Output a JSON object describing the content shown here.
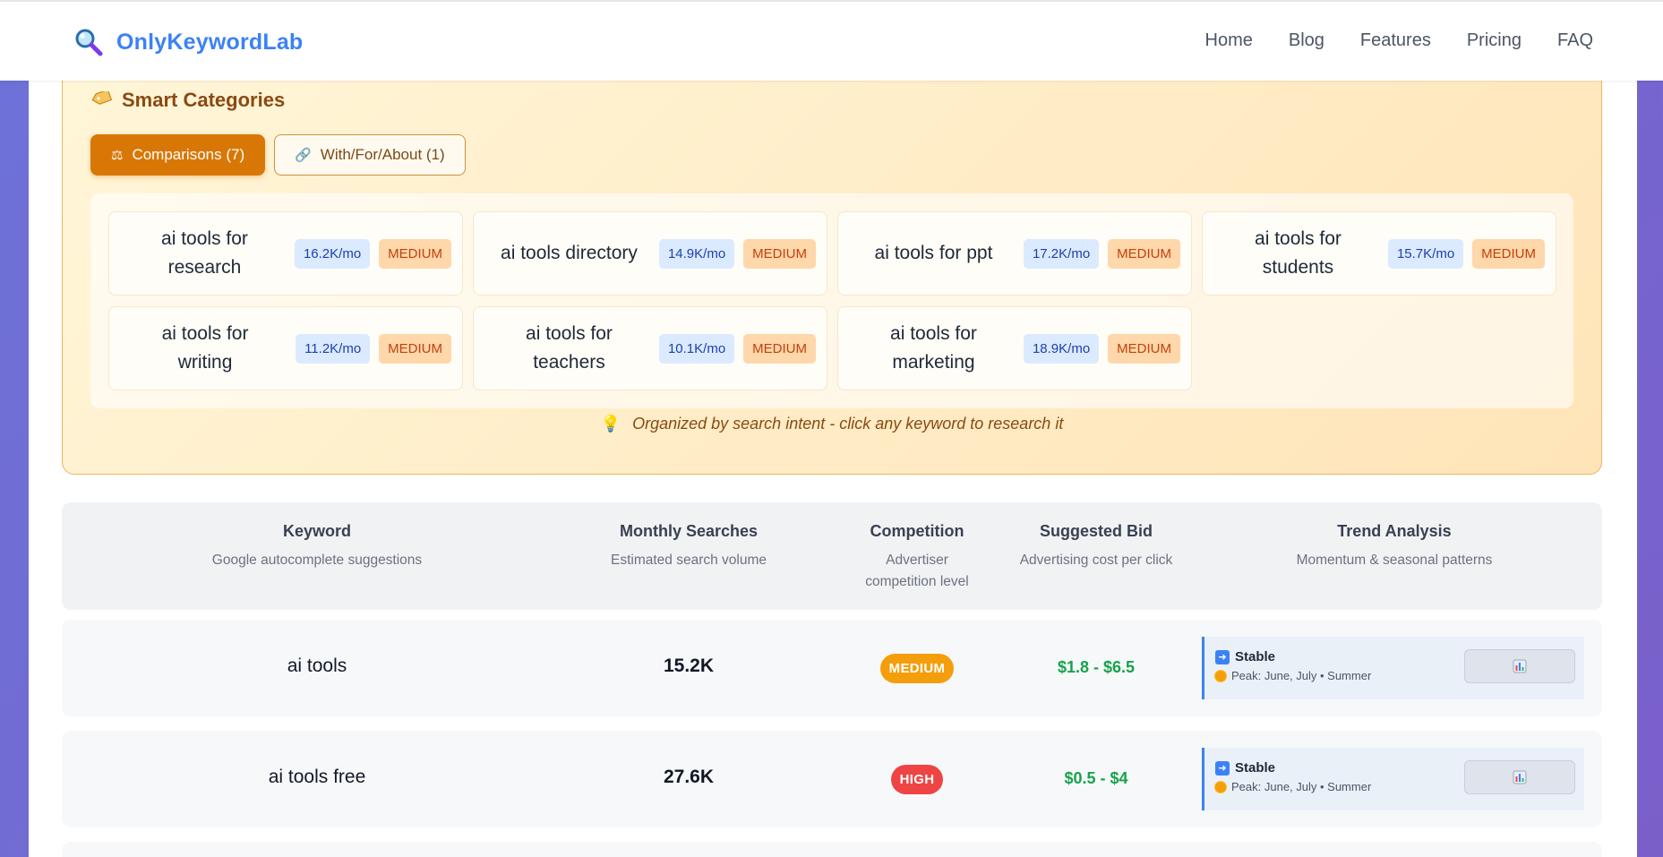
{
  "header": {
    "brand": "OnlyKeywordLab",
    "nav": [
      "Home",
      "Blog",
      "Features",
      "Pricing",
      "FAQ"
    ]
  },
  "smart": {
    "title": "Smart Categories",
    "tabs": [
      {
        "label": "Comparisons (7)",
        "icon": "scale-icon",
        "active": true
      },
      {
        "label": "With/For/About (1)",
        "icon": "link-icon",
        "active": false
      }
    ],
    "keywords": [
      {
        "name": "ai tools for research",
        "volume": "16.2K/mo",
        "competition": "MEDIUM"
      },
      {
        "name": "ai tools directory",
        "volume": "14.9K/mo",
        "competition": "MEDIUM"
      },
      {
        "name": "ai tools for ppt",
        "volume": "17.2K/mo",
        "competition": "MEDIUM"
      },
      {
        "name": "ai tools for students",
        "volume": "15.7K/mo",
        "competition": "MEDIUM"
      },
      {
        "name": "ai tools for writing",
        "volume": "11.2K/mo",
        "competition": "MEDIUM"
      },
      {
        "name": "ai tools for teachers",
        "volume": "10.1K/mo",
        "competition": "MEDIUM"
      },
      {
        "name": "ai tools for marketing",
        "volume": "18.9K/mo",
        "competition": "MEDIUM"
      }
    ],
    "hint": "Organized by search intent - click any keyword to research it"
  },
  "table": {
    "headers": [
      {
        "title": "Keyword",
        "sub": "Google autocomplete suggestions"
      },
      {
        "title": "Monthly Searches",
        "sub": "Estimated search volume"
      },
      {
        "title": "Competition",
        "sub": "Advertiser competition level"
      },
      {
        "title": "Suggested Bid",
        "sub": "Advertising cost per click"
      },
      {
        "title": "Trend Analysis",
        "sub": "Momentum & seasonal patterns"
      }
    ],
    "rows": [
      {
        "keyword": "ai tools",
        "volume": "15.2K",
        "competition": "MEDIUM",
        "competition_color": "#f59e0b",
        "bid": "$1.8 - $6.5",
        "trend": "Stable",
        "peak": "Peak: June, July • Summer"
      },
      {
        "keyword": "ai tools free",
        "volume": "27.6K",
        "competition": "HIGH",
        "competition_color": "#ef4444",
        "bid": "$0.5 - $4",
        "trend": "Stable",
        "peak": "Peak: June, July • Summer"
      }
    ]
  },
  "colors": {
    "accent": "#3b82f6",
    "active_tab": "#d97706",
    "bid_green": "#16a34a"
  }
}
